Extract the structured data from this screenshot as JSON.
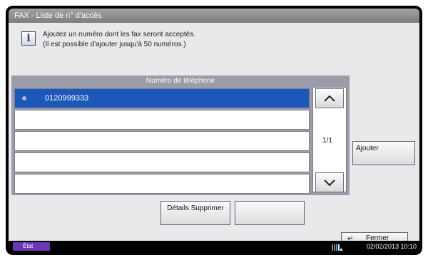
{
  "window": {
    "title": "FAX - Liste de n° d'accès"
  },
  "info": {
    "line1": "Ajoutez un numéro dont les fax seront acceptés.",
    "line2": "(Il est possible d'ajouter jusqu'à 50 numéros.)"
  },
  "list": {
    "header": "Numéro de téléphone",
    "rows": [
      "0120999333",
      "",
      "",
      "",
      ""
    ],
    "page": "1/1"
  },
  "buttons": {
    "add": "Ajouter",
    "details_delete": "Détails Supprimer",
    "blank": "",
    "close": "Fermer"
  },
  "status": {
    "state": "État",
    "datetime": "02/02/2013  10:10"
  }
}
